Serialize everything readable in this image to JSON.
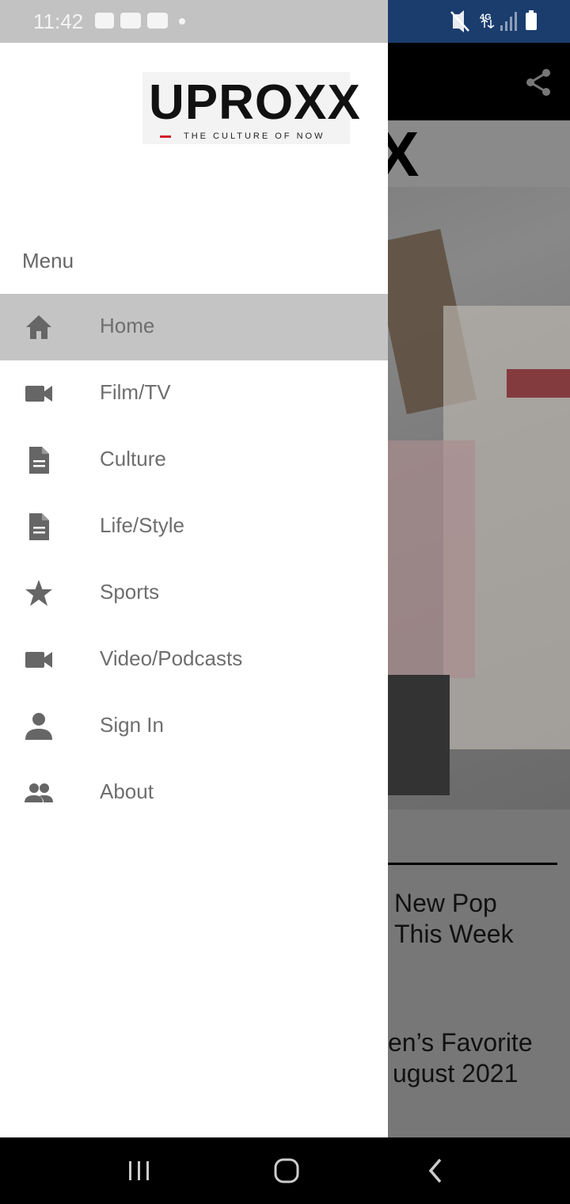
{
  "status_bar": {
    "time": "11:42"
  },
  "background": {
    "headline_1": "New Pop\nThis Week",
    "headline_1_line1": "New Pop",
    "headline_1_line2": "This Week",
    "headline_2_line1": "en’s Favorite",
    "headline_2_line2": "ugust 2021"
  },
  "drawer": {
    "logo": {
      "wordmark": "UPROXX",
      "tagline": "THE CULTURE OF NOW"
    },
    "menu_header": "Menu",
    "items": [
      {
        "label": "Home",
        "icon": "home-icon",
        "active": true
      },
      {
        "label": "Film/TV",
        "icon": "video-camera-icon",
        "active": false
      },
      {
        "label": "Culture",
        "icon": "document-icon",
        "active": false
      },
      {
        "label": "Life/Style",
        "icon": "document-icon",
        "active": false
      },
      {
        "label": "Sports",
        "icon": "star-icon",
        "active": false
      },
      {
        "label": "Video/Podcasts",
        "icon": "video-camera-icon",
        "active": false
      },
      {
        "label": "Sign In",
        "icon": "person-icon",
        "active": false
      },
      {
        "label": "About",
        "icon": "people-icon",
        "active": false
      }
    ]
  },
  "colors": {
    "drawer_bg": "#ffffff",
    "active_item_bg": "#c4c4c4",
    "icon_color": "#666666",
    "label_color": "#6e6e6e",
    "logo_accent": "#d0202a"
  }
}
